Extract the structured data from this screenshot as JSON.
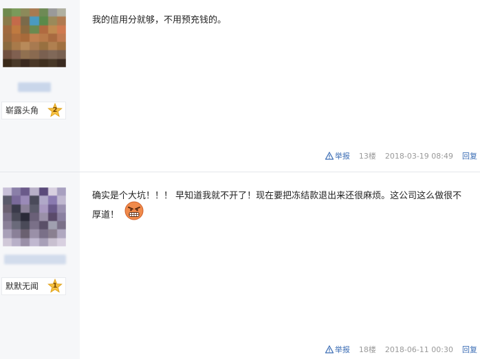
{
  "posts": [
    {
      "content": "我的信用分就够，不用预充钱的。",
      "level_name": "崭露头角",
      "level_number": "2",
      "report_label": "举报",
      "floor": "13楼",
      "timestamp": "2018-03-19 08:49",
      "reply_label": "回复"
    },
    {
      "content": "确实是个大坑！！！ 早知道我就不开了！现在要把冻结款退出来还很麻烦。这公司这么做很不厚道！",
      "level_name": "默默无闻",
      "level_number": "1",
      "report_label": "举报",
      "floor": "18楼",
      "timestamp": "2018-06-11 00:30",
      "reply_label": "回复"
    }
  ],
  "icons": {
    "report": "warning-triangle-icon",
    "level": "star-icon",
    "emoji": "angry-face-icon"
  },
  "colors": {
    "link": "#3a6cb4",
    "meta_text": "#999999",
    "sidebar_bg": "#f6f7f9",
    "star": "#f7c242"
  }
}
